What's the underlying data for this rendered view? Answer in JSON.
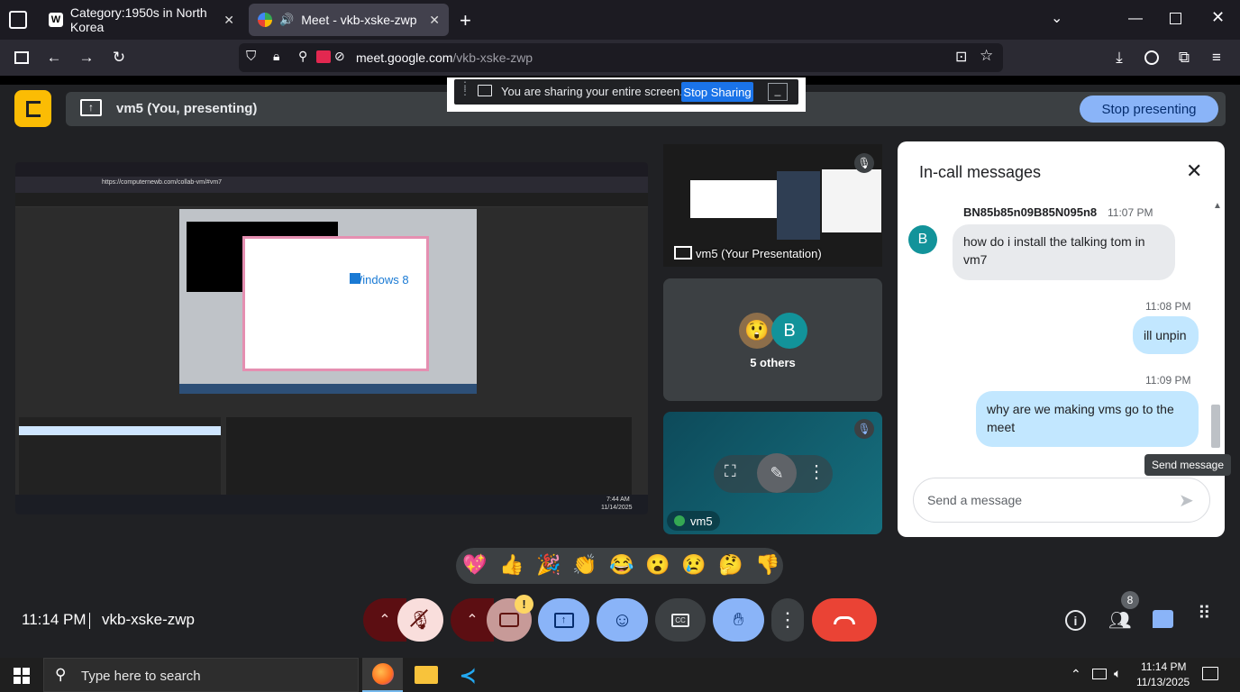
{
  "browser": {
    "tabs": [
      {
        "title": "Category:1950s in North Korea",
        "favicon": "W"
      },
      {
        "title": "Meet - vkb-xske-zwp",
        "favicon": "meet"
      }
    ],
    "url_host": "meet.google.com",
    "url_path": "/vkb-xske-zwp"
  },
  "share_banner": {
    "message": "You are sharing your entire screen.",
    "stop_sharing_label": "Stop Sharing"
  },
  "presenting_bar": {
    "label": "vm5 (You, presenting)",
    "stop_presenting_label": "Stop presenting"
  },
  "tiles": {
    "self_preview_label": "vm5 (Your Presentation)",
    "others_label": "5 others",
    "others_avatar_letter": "B",
    "self_name": "vm5"
  },
  "chat": {
    "title": "In-call messages",
    "messages": [
      {
        "sender": "BN85b85n09B85N095n8",
        "time": "11:07 PM",
        "text": "how do i install the talking tom in vm7",
        "avatar": "B"
      },
      {
        "sender": "",
        "time": "11:08 PM",
        "text": "ill unpin"
      },
      {
        "sender": "",
        "time": "11:09 PM",
        "text": "why are we making vms go to the meet"
      }
    ],
    "input_placeholder": "Send a message",
    "send_tooltip": "Send message"
  },
  "reactions": [
    "💖",
    "👍",
    "🎉",
    "👏",
    "😂",
    "😮",
    "😢",
    "🤔",
    "👎"
  ],
  "bottom_bar": {
    "time": "11:14 PM",
    "meeting_code": "vkb-xske-zwp",
    "people_count": "8",
    "camera_alert": "!"
  },
  "shared_screen": {
    "url": "https://computernewb.com/collab-vm/#vm7",
    "windows_logo_text": "Windows 8",
    "clock_time": "7:44 AM",
    "clock_date": "11/14/2025"
  },
  "taskbar": {
    "search_placeholder": "Type here to search",
    "time": "11:14 PM",
    "date": "11/13/2025"
  },
  "colors": {
    "meet_bg": "#202124",
    "accent_blue": "#8ab4f8",
    "hangup_red": "#ea4335",
    "chat_mine_bubble": "#c2e7ff",
    "teal_avatar": "#12939a"
  }
}
